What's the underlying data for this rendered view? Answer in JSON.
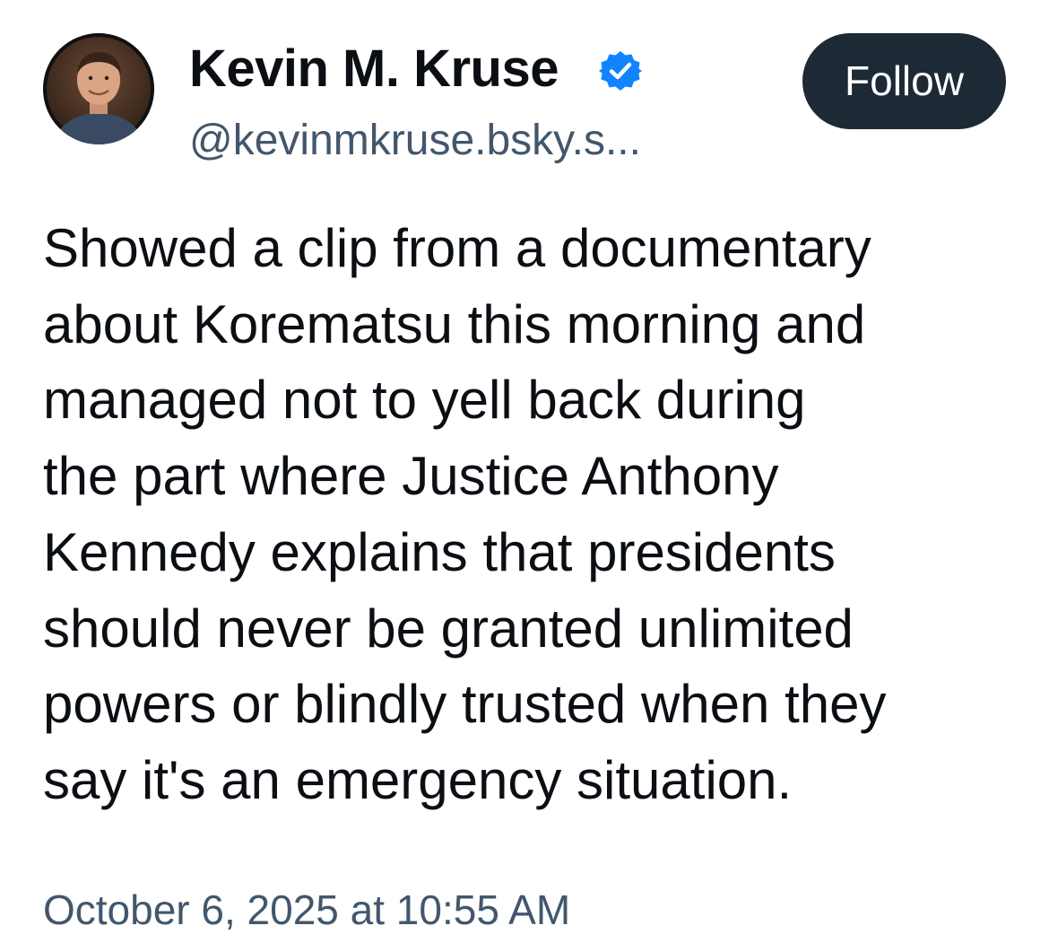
{
  "author": {
    "display_name": "Kevin M. Kruse",
    "handle": "@kevinmkruse.bsky.s...",
    "verified": true,
    "avatar_icon": "profile-photo",
    "verified_icon": "verified-check-badge"
  },
  "actions": {
    "follow_label": "Follow"
  },
  "post": {
    "lines": [
      "Showed a clip from a documentary",
      "about Korematsu this morning and",
      "managed not to yell back during",
      "the part where Justice Anthony",
      "Kennedy explains that presidents",
      "should never be granted unlimited",
      "powers or blindly trusted when they",
      "say it's an emergency situation."
    ],
    "timestamp": "October 6, 2025 at 10:55 AM"
  },
  "colors": {
    "text_primary": "#0b0f14",
    "text_secondary": "#42576c",
    "follow_button_bg": "#1e2936",
    "verified_blue": "#1083fe"
  }
}
